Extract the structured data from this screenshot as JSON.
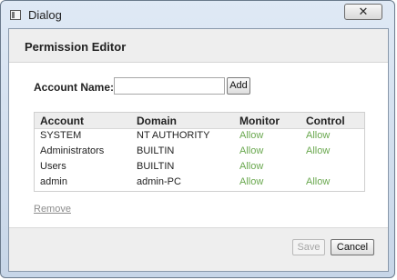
{
  "window": {
    "title": "Dialog",
    "close_label": "✕"
  },
  "dialog": {
    "heading": "Permission Editor",
    "account_label": "Account Name:",
    "account_value": "",
    "add_label": "Add"
  },
  "table": {
    "columns": [
      "Account",
      "Domain",
      "Monitor",
      "Control"
    ],
    "rows": [
      {
        "account": "SYSTEM",
        "domain": "NT AUTHORITY",
        "monitor": "Allow",
        "control": "Allow"
      },
      {
        "account": "Administrators",
        "domain": "BUILTIN",
        "monitor": "Allow",
        "control": "Allow"
      },
      {
        "account": "Users",
        "domain": "BUILTIN",
        "monitor": "Allow",
        "control": ""
      },
      {
        "account": "admin",
        "domain": "admin-PC",
        "monitor": "Allow",
        "control": "Allow"
      }
    ]
  },
  "actions": {
    "remove_label": "Remove",
    "save_label": "Save",
    "cancel_label": "Cancel"
  },
  "colors": {
    "allow": "#6aa84f",
    "header_band": "#eeeeee"
  },
  "icons": {
    "title_icon": "window-icon",
    "close_icon": "close-icon"
  }
}
